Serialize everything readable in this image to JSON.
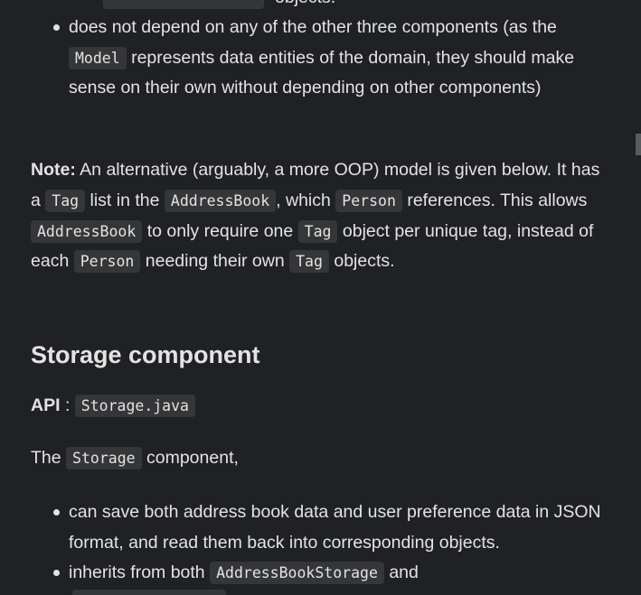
{
  "top_list": {
    "item1": {
      "text_a": "does not depend on any of the other three components (as the",
      "code": "Model",
      "text_b": "represents data entities of the domain, they should make sense on their own without depending on other components)"
    }
  },
  "clipped_above": {
    "text": "objects."
  },
  "note": {
    "label": "Note:",
    "t1": "An alternative (arguably, a more OOP) model is given below. It has a",
    "c1": "Tag",
    "t2": "list in the",
    "c2": "AddressBook",
    "t3": ", which",
    "c3": "Person",
    "t4": "references. This allows",
    "c4": "AddressBook",
    "t5": "to only require one",
    "c5": "Tag",
    "t6": "object per unique tag, instead of each",
    "c6": "Person",
    "t7": "needing their own",
    "c7": "Tag",
    "t8": "objects."
  },
  "storage": {
    "heading": "Storage component",
    "api_label": "API",
    "api_sep": ":",
    "api_file": "Storage.java",
    "intro_a": "The",
    "intro_code": "Storage",
    "intro_b": "component,",
    "items": [
      {
        "text": "can save both address book data and user preference data in JSON format, and read them back into corresponding objects."
      },
      {
        "text": "inherits from both",
        "code": "AddressBookStorage",
        "text_b": "and"
      }
    ]
  }
}
